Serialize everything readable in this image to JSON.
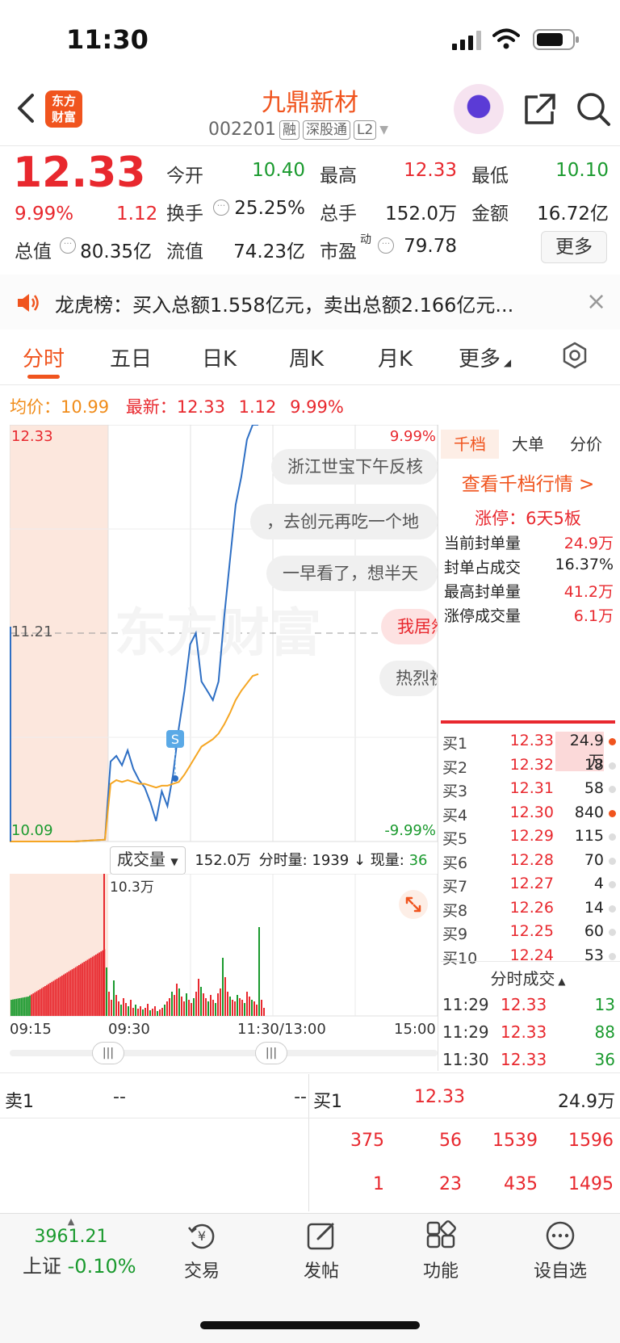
{
  "status_bar": {
    "time": "11:30"
  },
  "header": {
    "logo_text_line1": "东方",
    "logo_text_line2": "财富",
    "stock_name": "九鼎新材",
    "stock_code": "002201",
    "tags": [
      "融",
      "深股通",
      "L2"
    ]
  },
  "quote": {
    "price": "12.33",
    "change_pct": "9.99%",
    "change": "1.12",
    "fields": {
      "open_label": "今开",
      "open": "10.40",
      "high_label": "最高",
      "high": "12.33",
      "low_label": "最低",
      "low": "10.10",
      "turnover_label": "换手",
      "turnover": "25.25%",
      "volume_label": "总手",
      "volume": "152.0万",
      "amount_label": "金额",
      "amount": "16.72亿",
      "mktcap_label": "总值",
      "mktcap": "80.35亿",
      "float_label": "流值",
      "float": "74.23亿",
      "pe_label": "市盈",
      "pe_sup": "动",
      "pe": "79.78"
    },
    "more_label": "更多"
  },
  "news": {
    "text": "龙虎榜：买入总额1.558亿元，卖出总额2.166亿元..."
  },
  "tabs": [
    "分时",
    "五日",
    "日K",
    "周K",
    "月K",
    "更多"
  ],
  "avg_row": {
    "avg_label": "均价：",
    "avg": "10.99",
    "latest_label": "最新：",
    "latest": "12.33",
    "latest_chg": "1.12",
    "latest_pct": "9.99%"
  },
  "chart_data": {
    "type": "line",
    "y_top": "12.33",
    "y_mid": "11.21",
    "y_bottom": "10.09",
    "pct_top": "9.99%",
    "pct_bottom": "-9.99%",
    "ylim": [
      10.09,
      12.33
    ],
    "watermark": "东方财富",
    "marker": "S",
    "x_labels": [
      "09:15",
      "09:30",
      "11:30/13:00",
      "15:00"
    ],
    "series": [
      {
        "name": "price",
        "values": [
          10.09,
          10.09,
          10.09,
          10.1,
          10.52,
          10.55,
          10.5,
          10.58,
          10.48,
          10.42,
          10.38,
          10.3,
          10.2,
          10.36,
          10.28,
          10.45,
          10.7,
          10.9,
          11.15,
          11.21,
          10.95,
          10.9,
          10.85,
          10.95,
          11.3,
          11.6,
          11.9,
          12.05,
          12.25,
          12.33,
          12.33
        ]
      },
      {
        "name": "avg",
        "values": [
          10.09,
          10.09,
          10.09,
          10.1,
          10.4,
          10.42,
          10.41,
          10.42,
          10.41,
          10.4,
          10.4,
          10.39,
          10.38,
          10.39,
          10.39,
          10.4,
          10.41,
          10.45,
          10.5,
          10.55,
          10.6,
          10.62,
          10.64,
          10.67,
          10.72,
          10.78,
          10.85,
          10.9,
          10.94,
          10.98,
          10.99
        ]
      }
    ]
  },
  "bubbles": [
    "浙江世宝下午反核",
    "，去创元再吃一个地",
    "一早看了，想半天",
    "我居然",
    "热烈祝"
  ],
  "right_panel": {
    "tabs": [
      "千档",
      "大单",
      "分价"
    ],
    "link": "查看千档行情 >",
    "limit_title": "涨停：6天5板",
    "limit_rows": [
      {
        "label": "当前封单量",
        "value": "24.9万"
      },
      {
        "label": "封单占成交",
        "value": "16.37%"
      },
      {
        "label": "最高封单量",
        "value": "41.2万"
      },
      {
        "label": "涨停成交量",
        "value": "6.1万"
      }
    ],
    "bids": [
      {
        "label": "买1",
        "price": "12.33",
        "vol": "24.9万",
        "hot": true
      },
      {
        "label": "买2",
        "price": "12.32",
        "vol": "18",
        "hot": false
      },
      {
        "label": "买3",
        "price": "12.31",
        "vol": "58",
        "hot": false
      },
      {
        "label": "买4",
        "price": "12.30",
        "vol": "840",
        "hot": true
      },
      {
        "label": "买5",
        "price": "12.29",
        "vol": "115",
        "hot": false
      },
      {
        "label": "买6",
        "price": "12.28",
        "vol": "70",
        "hot": false
      },
      {
        "label": "买7",
        "price": "12.27",
        "vol": "4",
        "hot": false
      },
      {
        "label": "买8",
        "price": "12.26",
        "vol": "14",
        "hot": false
      },
      {
        "label": "买9",
        "price": "12.25",
        "vol": "60",
        "hot": false
      },
      {
        "label": "买10",
        "price": "12.24",
        "vol": "53",
        "hot": false
      }
    ],
    "ticks_title": "分时成交",
    "ticks": [
      {
        "time": "11:29",
        "price": "12.33",
        "vol": "13",
        "color": "#1a9a2e"
      },
      {
        "time": "11:29",
        "price": "12.33",
        "vol": "88",
        "color": "#1a9a2e"
      },
      {
        "time": "11:30",
        "price": "12.33",
        "vol": "36",
        "color": "#1a9a2e"
      }
    ]
  },
  "volume": {
    "selector": "成交量",
    "total": "152.0万",
    "minute_label": "分时量:",
    "minute": "1939",
    "now_label": "现量:",
    "now": "36",
    "max_label": "10.3万"
  },
  "order_book_bottom": {
    "sell1_label": "卖1",
    "sell1_price": "--",
    "sell1_vol": "--",
    "buy1_label": "买1",
    "buy1_price": "12.33",
    "buy1_vol": "24.9万",
    "row1": [
      "375",
      "56",
      "1539",
      "1596"
    ],
    "row2": [
      "1",
      "23",
      "435",
      "1495"
    ]
  },
  "bottom_nav": {
    "index_value": "3961.21",
    "index_name": "上证",
    "index_pct": "-0.10%",
    "items": [
      "交易",
      "发帖",
      "功能",
      "设自选"
    ]
  },
  "colors": {
    "accent": "#f0541e",
    "up": "#e8282e",
    "down": "#1a9a2e",
    "avg_line": "#f5a623",
    "price_line": "#2e6fc4"
  }
}
